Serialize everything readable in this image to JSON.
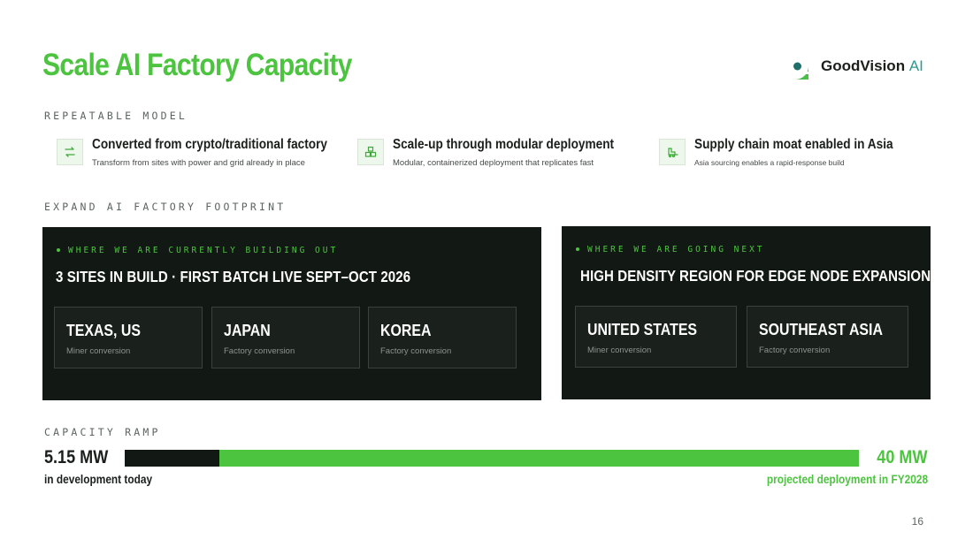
{
  "title": "Scale AI Factory Capacity",
  "logo": {
    "name": "GoodVision",
    "suffix": "AI",
    "brand_color": "#2e9a8e"
  },
  "colors": {
    "accent": "#4cc43f",
    "panel": "#121814"
  },
  "sections": {
    "model": "REPEATABLE MODEL",
    "footprint": "EXPAND AI FACTORY FOOTPRINT",
    "ramp": "CAPACITY RAMP"
  },
  "features": [
    {
      "icon": "convert-arrows-icon",
      "title": "Converted from crypto/traditional factory",
      "subtitle": "Transform from sites with power and grid already in place"
    },
    {
      "icon": "modular-blocks-icon",
      "title": "Scale-up through modular deployment",
      "subtitle": "Modular, containerized deployment that replicates fast"
    },
    {
      "icon": "forklift-icon",
      "title": "Supply chain moat enabled in Asia",
      "subtitle": "Asia sourcing enables a rapid-response build"
    }
  ],
  "current": {
    "kicker": "WHERE WE ARE CURRENTLY BUILDING OUT",
    "headline": "3 SITES IN BUILD · FIRST BATCH LIVE SEPT–OCT 2026",
    "sites": [
      {
        "name": "TEXAS, US",
        "type": "Miner conversion"
      },
      {
        "name": "JAPAN",
        "type": "Factory conversion"
      },
      {
        "name": "KOREA",
        "type": "Factory conversion"
      }
    ]
  },
  "next": {
    "kicker": "WHERE WE ARE GOING NEXT",
    "headline": "HIGH DENSITY REGION FOR EDGE NODE EXPANSION",
    "sites": [
      {
        "name": "UNITED STATES",
        "type": "Miner conversion"
      },
      {
        "name": "SOUTHEAST ASIA",
        "type": "Factory conversion"
      }
    ]
  },
  "ramp": {
    "current_value": "5.15 MW",
    "current_label": "in development today",
    "target_value": "40 MW",
    "target_label": "projected deployment in FY2028",
    "current_mw": 5.15,
    "target_mw": 40
  },
  "page_number": "16"
}
